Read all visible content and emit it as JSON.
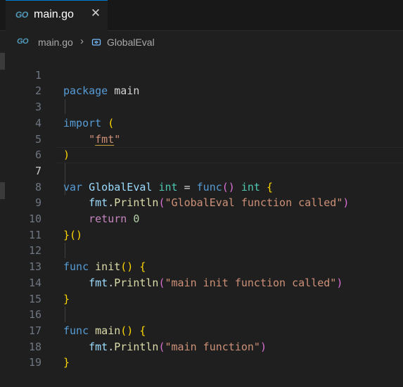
{
  "tab": {
    "icon": "go-file-icon",
    "logo_text": "GO",
    "label": "main.go",
    "close_glyph": "✕"
  },
  "breadcrumb": {
    "logo_text": "GO",
    "file": "main.go",
    "separator": "›",
    "symbol_icon": "variable-symbol-icon",
    "symbol": "GlobalEval"
  },
  "editor": {
    "active_line": 7,
    "lines": [
      {
        "n": "1"
      },
      {
        "n": "2"
      },
      {
        "n": "3"
      },
      {
        "n": "4"
      },
      {
        "n": "5"
      },
      {
        "n": "6"
      },
      {
        "n": "7"
      },
      {
        "n": "8"
      },
      {
        "n": "9"
      },
      {
        "n": "10"
      },
      {
        "n": "11"
      },
      {
        "n": "12"
      },
      {
        "n": "13"
      },
      {
        "n": "14"
      },
      {
        "n": "15"
      },
      {
        "n": "16"
      },
      {
        "n": "17"
      },
      {
        "n": "18"
      },
      {
        "n": "19"
      }
    ],
    "tokens": {
      "l1": [
        "package",
        " main"
      ],
      "l3": [
        "import",
        " ",
        "("
      ],
      "l4": [
        "\"",
        "fmt",
        "\""
      ],
      "l5": [
        ")"
      ],
      "l7": [
        "var",
        " ",
        "GlobalEval",
        " ",
        "int",
        " = ",
        "func",
        "()",
        " ",
        "int",
        " ",
        "{"
      ],
      "l8": [
        "fmt",
        ".",
        "Println",
        "(",
        "\"GlobalEval function called\"",
        ")"
      ],
      "l9": [
        "return",
        " ",
        "0"
      ],
      "l10": [
        "}",
        "()"
      ],
      "l12": [
        "func",
        " ",
        "init",
        "()",
        " ",
        "{"
      ],
      "l13": [
        "fmt",
        ".",
        "Println",
        "(",
        "\"main init function called\"",
        ")"
      ],
      "l14": [
        "}"
      ],
      "l16": [
        "func",
        " ",
        "main",
        "()",
        " ",
        "{"
      ],
      "l17": [
        "fmt",
        ".",
        "Println",
        "(",
        "\"main function\"",
        ")"
      ],
      "l18": [
        "}"
      ]
    }
  },
  "colors": {
    "background": "#1f1f1f",
    "tab_accent": "#0078d4",
    "go_brand": "#519aba",
    "keyword": "#569cd6",
    "string": "#ce9178",
    "bracket": "#ffd700"
  }
}
